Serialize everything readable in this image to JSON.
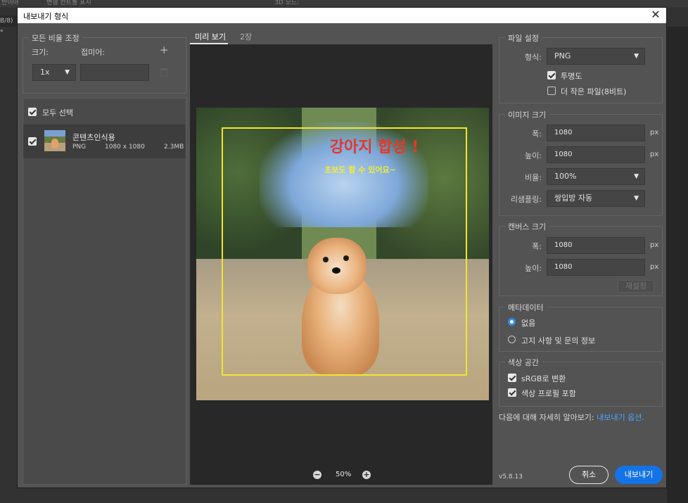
{
  "app": {
    "topbar_items": [
      "반이아",
      "변형 컨트롤 표시",
      "3D 모드:"
    ],
    "tab_stub": "B/8) *"
  },
  "dialog": {
    "title": "내보내기 형식"
  },
  "scale": {
    "group_label": "모든 비율 조정",
    "size_label": "크기:",
    "suffix_label": "접미어:",
    "size_value": "1x",
    "suffix_value": ""
  },
  "layers": {
    "select_all_label": "모두 선택",
    "items": [
      {
        "name": "콘텐츠인식용",
        "format": "PNG",
        "dimensions": "1080 x 1080",
        "size": "2.3MB"
      }
    ]
  },
  "preview": {
    "tabs": [
      "미리 보기",
      "2장"
    ],
    "image_title": "강아지 합성 !",
    "image_subtitle": "초보도 할 수 있어요~",
    "zoom": "50%"
  },
  "file_settings": {
    "group_label": "파일 설정",
    "format_label": "형식:",
    "format_value": "PNG",
    "transparency_label": "투명도",
    "smaller_file_label": "더 작은 파일(8비트)"
  },
  "image_size": {
    "group_label": "이미지 크기",
    "width_label": "폭:",
    "width_value": "1080",
    "height_label": "높이:",
    "height_value": "1080",
    "ratio_label": "비율:",
    "ratio_value": "100%",
    "resample_label": "리샘플링:",
    "resample_value": "쌍입방 자동",
    "unit": "px"
  },
  "canvas_size": {
    "group_label": "캔버스 크기",
    "width_label": "폭:",
    "width_value": "1080",
    "height_label": "높이:",
    "height_value": "1080",
    "unit": "px",
    "reset_label": "재설정"
  },
  "metadata": {
    "group_label": "메타데이터",
    "option_none": "없음",
    "option_copyright": "고지 사항 및 문의 정보"
  },
  "color_space": {
    "group_label": "색상 공간",
    "srgb_label": "sRGB로 변환",
    "embed_label": "색상 프로필 포함"
  },
  "footer": {
    "learn_more_text": "다음에 대해 자세히 알아보기:",
    "learn_more_link": "내보내기 옵션.",
    "version": "v5.8.13",
    "cancel_label": "취소",
    "export_label": "내보내기"
  },
  "colors": {
    "accent": "#1473e6",
    "link": "#4ea3f5",
    "dialog_bg": "#535353"
  }
}
